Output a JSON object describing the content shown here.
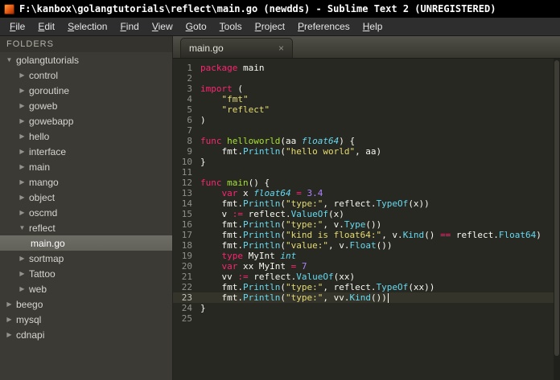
{
  "window": {
    "title": "F:\\kanbox\\golangtutorials\\reflect\\main.go (newdds) - Sublime Text 2 (UNREGISTERED)"
  },
  "menu": {
    "items": [
      "File",
      "Edit",
      "Selection",
      "Find",
      "View",
      "Goto",
      "Tools",
      "Project",
      "Preferences",
      "Help"
    ]
  },
  "sidebar": {
    "header": "FOLDERS",
    "icons": {
      "expanded": "▼",
      "collapsed": "▶"
    },
    "items": [
      {
        "label": "golangtutorials",
        "level": 0,
        "state": "expanded",
        "selected": false
      },
      {
        "label": "control",
        "level": 1,
        "state": "collapsed",
        "selected": false
      },
      {
        "label": "goroutine",
        "level": 1,
        "state": "collapsed",
        "selected": false
      },
      {
        "label": "goweb",
        "level": 1,
        "state": "collapsed",
        "selected": false
      },
      {
        "label": "gowebapp",
        "level": 1,
        "state": "collapsed",
        "selected": false
      },
      {
        "label": "hello",
        "level": 1,
        "state": "collapsed",
        "selected": false
      },
      {
        "label": "interface",
        "level": 1,
        "state": "collapsed",
        "selected": false
      },
      {
        "label": "main",
        "level": 1,
        "state": "collapsed",
        "selected": false
      },
      {
        "label": "mango",
        "level": 1,
        "state": "collapsed",
        "selected": false
      },
      {
        "label": "object",
        "level": 1,
        "state": "collapsed",
        "selected": false
      },
      {
        "label": "oscmd",
        "level": 1,
        "state": "collapsed",
        "selected": false
      },
      {
        "label": "reflect",
        "level": 1,
        "state": "expanded",
        "selected": false
      },
      {
        "label": "main.go",
        "level": 2,
        "state": "file",
        "selected": true
      },
      {
        "label": "sortmap",
        "level": 1,
        "state": "collapsed",
        "selected": false
      },
      {
        "label": "Tattoo",
        "level": 1,
        "state": "collapsed",
        "selected": false
      },
      {
        "label": "web",
        "level": 1,
        "state": "collapsed",
        "selected": false
      },
      {
        "label": "beego",
        "level": 0,
        "state": "collapsed",
        "selected": false
      },
      {
        "label": "mysql",
        "level": 0,
        "state": "collapsed",
        "selected": false
      },
      {
        "label": "cdnapi",
        "level": 0,
        "state": "collapsed",
        "selected": false
      }
    ]
  },
  "tabbar": {
    "tabs": [
      {
        "label": "main.go",
        "close": "×",
        "active": true
      }
    ]
  },
  "editor": {
    "current_line": 23,
    "lines": [
      {
        "n": 1,
        "seg": [
          [
            "package",
            "kw"
          ],
          [
            " main",
            "pl"
          ]
        ]
      },
      {
        "n": 2,
        "seg": []
      },
      {
        "n": 3,
        "seg": [
          [
            "import",
            "kw"
          ],
          [
            " (",
            "pl"
          ]
        ]
      },
      {
        "n": 4,
        "seg": [
          [
            "    ",
            "pl"
          ],
          [
            "\"fmt\"",
            "st"
          ]
        ]
      },
      {
        "n": 5,
        "seg": [
          [
            "    ",
            "pl"
          ],
          [
            "\"reflect\"",
            "st"
          ]
        ]
      },
      {
        "n": 6,
        "seg": [
          [
            ")",
            "pl"
          ]
        ]
      },
      {
        "n": 7,
        "seg": []
      },
      {
        "n": 8,
        "seg": [
          [
            "func",
            "kw"
          ],
          [
            " ",
            "pl"
          ],
          [
            "helloworld",
            "fn"
          ],
          [
            "(aa ",
            "pl"
          ],
          [
            "float64",
            "ty"
          ],
          [
            ") {",
            "pl"
          ]
        ]
      },
      {
        "n": 9,
        "seg": [
          [
            "    fmt.",
            "pl"
          ],
          [
            "Println",
            "ca"
          ],
          [
            "(",
            "pl"
          ],
          [
            "\"hello world\"",
            "st"
          ],
          [
            ", aa)",
            "pl"
          ]
        ]
      },
      {
        "n": 10,
        "seg": [
          [
            "}",
            "pl"
          ]
        ]
      },
      {
        "n": 11,
        "seg": []
      },
      {
        "n": 12,
        "seg": [
          [
            "func",
            "kw"
          ],
          [
            " ",
            "pl"
          ],
          [
            "main",
            "fn"
          ],
          [
            "() {",
            "pl"
          ]
        ]
      },
      {
        "n": 13,
        "seg": [
          [
            "    ",
            "pl"
          ],
          [
            "var",
            "kw"
          ],
          [
            " x ",
            "pl"
          ],
          [
            "float64",
            "ty"
          ],
          [
            " ",
            "pl"
          ],
          [
            "=",
            "op"
          ],
          [
            " ",
            "pl"
          ],
          [
            "3.4",
            "nu"
          ]
        ]
      },
      {
        "n": 14,
        "seg": [
          [
            "    fmt.",
            "pl"
          ],
          [
            "Println",
            "ca"
          ],
          [
            "(",
            "pl"
          ],
          [
            "\"type:\"",
            "st"
          ],
          [
            ", reflect.",
            "pl"
          ],
          [
            "TypeOf",
            "ca"
          ],
          [
            "(x))",
            "pl"
          ]
        ]
      },
      {
        "n": 15,
        "seg": [
          [
            "    v ",
            "pl"
          ],
          [
            ":=",
            "op"
          ],
          [
            " reflect.",
            "pl"
          ],
          [
            "ValueOf",
            "ca"
          ],
          [
            "(x)",
            "pl"
          ]
        ]
      },
      {
        "n": 16,
        "seg": [
          [
            "    fmt.",
            "pl"
          ],
          [
            "Println",
            "ca"
          ],
          [
            "(",
            "pl"
          ],
          [
            "\"type:\"",
            "st"
          ],
          [
            ", v.",
            "pl"
          ],
          [
            "Type",
            "ca"
          ],
          [
            "())",
            "pl"
          ]
        ]
      },
      {
        "n": 17,
        "seg": [
          [
            "    fmt.",
            "pl"
          ],
          [
            "Println",
            "ca"
          ],
          [
            "(",
            "pl"
          ],
          [
            "\"kind is float64:\"",
            "st"
          ],
          [
            ", v.",
            "pl"
          ],
          [
            "Kind",
            "ca"
          ],
          [
            "() ",
            "pl"
          ],
          [
            "==",
            "op"
          ],
          [
            " reflect.",
            "pl"
          ],
          [
            "Float64",
            "ca"
          ],
          [
            ")",
            "pl"
          ]
        ]
      },
      {
        "n": 18,
        "seg": [
          [
            "    fmt.",
            "pl"
          ],
          [
            "Println",
            "ca"
          ],
          [
            "(",
            "pl"
          ],
          [
            "\"value:\"",
            "st"
          ],
          [
            ", v.",
            "pl"
          ],
          [
            "Float",
            "ca"
          ],
          [
            "())",
            "pl"
          ]
        ]
      },
      {
        "n": 19,
        "seg": [
          [
            "    ",
            "pl"
          ],
          [
            "type",
            "kw"
          ],
          [
            " MyInt ",
            "pl"
          ],
          [
            "int",
            "ty"
          ]
        ]
      },
      {
        "n": 20,
        "seg": [
          [
            "    ",
            "pl"
          ],
          [
            "var",
            "kw"
          ],
          [
            " xx MyInt ",
            "pl"
          ],
          [
            "=",
            "op"
          ],
          [
            " ",
            "pl"
          ],
          [
            "7",
            "nu"
          ]
        ]
      },
      {
        "n": 21,
        "seg": [
          [
            "    vv ",
            "pl"
          ],
          [
            ":=",
            "op"
          ],
          [
            " reflect.",
            "pl"
          ],
          [
            "ValueOf",
            "ca"
          ],
          [
            "(xx)",
            "pl"
          ]
        ]
      },
      {
        "n": 22,
        "seg": [
          [
            "    fmt.",
            "pl"
          ],
          [
            "Println",
            "ca"
          ],
          [
            "(",
            "pl"
          ],
          [
            "\"type:\"",
            "st"
          ],
          [
            ", reflect.",
            "pl"
          ],
          [
            "TypeOf",
            "ca"
          ],
          [
            "(xx))",
            "pl"
          ]
        ]
      },
      {
        "n": 23,
        "seg": [
          [
            "    fmt.",
            "pl"
          ],
          [
            "Println",
            "ca"
          ],
          [
            "(",
            "pl"
          ],
          [
            "\"type:\"",
            "st"
          ],
          [
            ", vv.",
            "pl"
          ],
          [
            "Kind",
            "ca"
          ],
          [
            "())",
            "pl"
          ]
        ]
      },
      {
        "n": 24,
        "seg": [
          [
            "}",
            "pl"
          ]
        ]
      },
      {
        "n": 25,
        "seg": []
      }
    ]
  },
  "theme": {
    "editor-bg": "#272822",
    "keyword": "#f92672",
    "function-name": "#a6e22e",
    "type": "#66d9ef",
    "string": "#e6db74",
    "number": "#ae81ff",
    "call": "#66d9ef",
    "plain": "#f8f8f2",
    "gutter": "#8f908a",
    "sidebar-bg": "#3b3a35",
    "selection-bg": "#62615a",
    "current-line-bg": "#34342b",
    "titlebar-bg": "#000000",
    "menubar-bg": "#2e2e2e",
    "tabbar-bg": "#45443d"
  }
}
